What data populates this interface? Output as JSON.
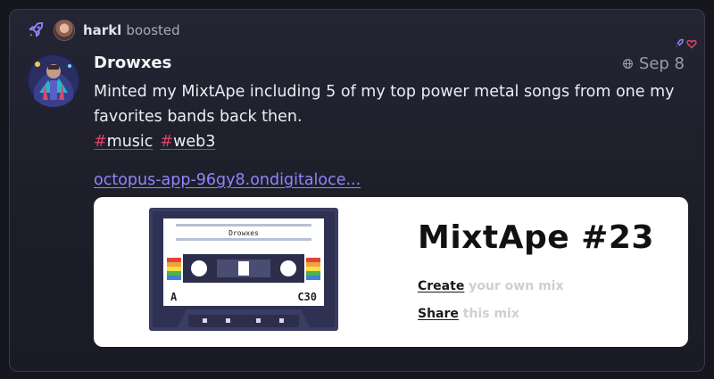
{
  "boost": {
    "booster_name": "harkl",
    "action_text": "boosted"
  },
  "post": {
    "display_name": "Drowxes",
    "date": "Sep 8",
    "text": "Minted my MixtApe including 5 of my top power metal songs from one my favorites bands back then.",
    "tags": [
      {
        "hash": "#",
        "name": "music"
      },
      {
        "hash": "#",
        "name": "web3"
      }
    ],
    "link_text": "octopus-app-96gy8.ondigitaloce..."
  },
  "preview": {
    "cassette_label": "Drowxes",
    "side_label": "A",
    "counter_label": "C30",
    "title": "MixtApe #23",
    "create_action": "Create",
    "create_rest": " your own mix",
    "share_action": "Share",
    "share_rest": " this mix"
  },
  "icons": {
    "boost": "rocket-icon",
    "visibility": "globe-icon",
    "boosted_indicator": "rocket-small-icon",
    "liked_indicator": "heart-icon"
  },
  "colors": {
    "accent_link": "#8e86ff",
    "hashtag": "#d9436a",
    "background": "#16161f"
  }
}
